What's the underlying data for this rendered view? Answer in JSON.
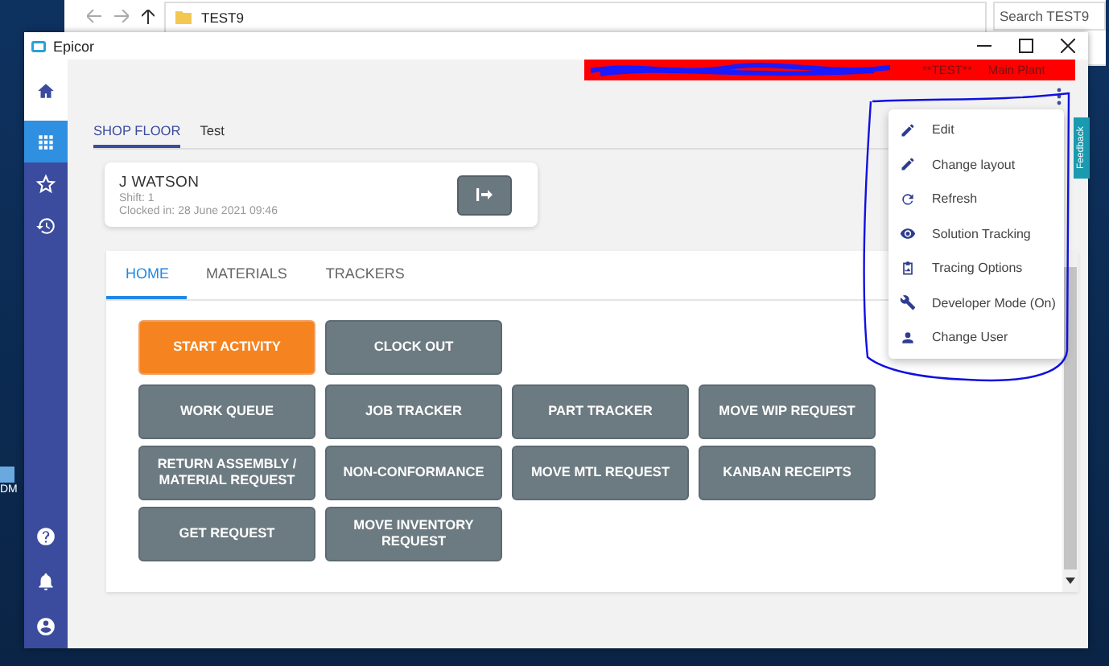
{
  "explorer": {
    "path": "TEST9",
    "placeholder": "Search TEST9"
  },
  "desktop_icon": {
    "label": "DM"
  },
  "window": {
    "title": "Epicor"
  },
  "banner": {
    "texts": [
      "**TEST**",
      "Main Plant"
    ]
  },
  "sidebar": {
    "items": [
      {
        "kind": "home",
        "selected": true,
        "highlighted": false
      },
      {
        "kind": "apps",
        "selected": false,
        "highlighted": true
      },
      {
        "kind": "star",
        "selected": false,
        "highlighted": false
      },
      {
        "kind": "history",
        "selected": false,
        "highlighted": false
      }
    ],
    "bottom_items": [
      {
        "kind": "help"
      },
      {
        "kind": "bell"
      },
      {
        "kind": "user"
      }
    ]
  },
  "page_tabs": [
    {
      "label": "SHOP FLOOR",
      "selected": true
    },
    {
      "label": "Test",
      "selected": false
    }
  ],
  "user_card": {
    "name": "J WATSON",
    "shift": "Shift: 1",
    "clocked_in": "Clocked in: 28 June 2021 09:46"
  },
  "tabs": [
    {
      "label": "HOME",
      "selected": true
    },
    {
      "label": "MATERIALS",
      "selected": false
    },
    {
      "label": "TRACKERS",
      "selected": false
    }
  ],
  "actions": [
    [
      {
        "label": "START ACTIVITY",
        "kind": "primary"
      },
      {
        "label": "CLOCK OUT",
        "kind": "secondary"
      }
    ],
    [
      {
        "label": "WORK QUEUE",
        "kind": "secondary"
      },
      {
        "label": "JOB TRACKER",
        "kind": "secondary"
      },
      {
        "label": "PART TRACKER",
        "kind": "secondary"
      },
      {
        "label": "MOVE WIP REQUEST",
        "kind": "secondary"
      }
    ],
    [
      {
        "label": "RETURN ASSEMBLY / MATERIAL REQUEST",
        "kind": "secondary"
      },
      {
        "label": "NON-CONFORMANCE",
        "kind": "secondary"
      },
      {
        "label": "MOVE MTL REQUEST",
        "kind": "secondary"
      },
      {
        "label": "KANBAN RECEIPTS",
        "kind": "secondary"
      }
    ],
    [
      {
        "label": "GET REQUEST",
        "kind": "secondary"
      },
      {
        "label": "MOVE INVENTORY REQUEST",
        "kind": "secondary"
      }
    ]
  ],
  "menu": {
    "items": [
      {
        "label": "Edit",
        "kind": "pencil"
      },
      {
        "label": "Change layout",
        "kind": "pencil"
      },
      {
        "label": "Refresh",
        "kind": "refresh"
      },
      {
        "label": "Solution Tracking",
        "kind": "eye"
      },
      {
        "label": "Tracing Options",
        "kind": "clipboard"
      },
      {
        "label": "Developer Mode (On)",
        "kind": "wrench"
      },
      {
        "label": "Change User",
        "kind": "person"
      }
    ]
  },
  "feedback": {
    "label": "Feedback"
  }
}
